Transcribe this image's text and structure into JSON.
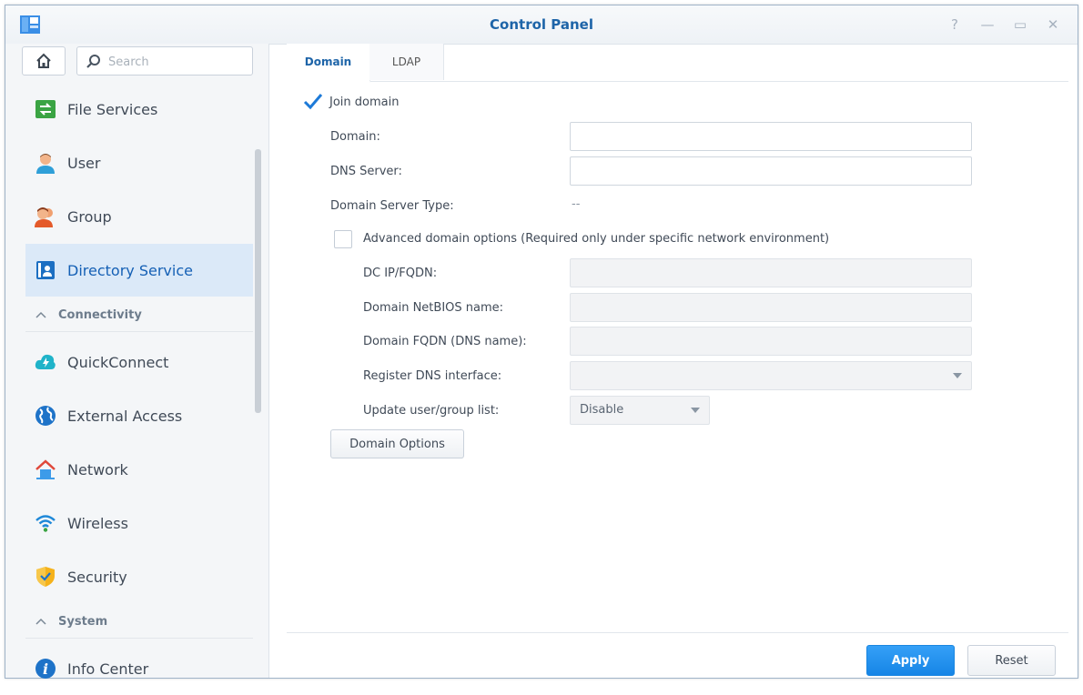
{
  "window": {
    "title": "Control Panel",
    "help_label": "?",
    "minimize_label": "—",
    "maximize_label": "▭",
    "close_label": "✕"
  },
  "sidebar": {
    "search_placeholder": "Search",
    "items_top": [
      {
        "label": "File Services",
        "icon": "file-services-icon"
      },
      {
        "label": "User",
        "icon": "user-icon"
      },
      {
        "label": "Group",
        "icon": "group-icon"
      },
      {
        "label": "Directory Service",
        "icon": "directory-service-icon",
        "active": true
      }
    ],
    "section_connectivity": "Connectivity",
    "items_connectivity": [
      {
        "label": "QuickConnect",
        "icon": "quickconnect-icon"
      },
      {
        "label": "External Access",
        "icon": "external-access-icon"
      },
      {
        "label": "Network",
        "icon": "network-icon"
      },
      {
        "label": "Wireless",
        "icon": "wireless-icon"
      },
      {
        "label": "Security",
        "icon": "security-icon"
      }
    ],
    "section_system": "System",
    "items_system": [
      {
        "label": "Info Center",
        "icon": "info-center-icon"
      }
    ]
  },
  "tabs": [
    {
      "label": "Domain",
      "active": true
    },
    {
      "label": "LDAP",
      "active": false
    }
  ],
  "form": {
    "join_domain_label": "Join domain",
    "join_domain_checked": true,
    "domain_label": "Domain:",
    "domain_value": "",
    "dns_server_label": "DNS Server:",
    "dns_server_value": "",
    "domain_server_type_label": "Domain Server Type:",
    "domain_server_type_value": "--",
    "advanced_label": "Advanced domain options (Required only under specific network environment)",
    "advanced_checked": false,
    "dc_ip_label": "DC IP/FQDN:",
    "netbios_label": "Domain NetBIOS name:",
    "fqdn_label": "Domain FQDN (DNS name):",
    "register_dns_label": "Register DNS interface:",
    "register_dns_value": "",
    "update_list_label": "Update user/group list:",
    "update_list_value": "Disable",
    "domain_options_button": "Domain Options"
  },
  "footer": {
    "apply_label": "Apply",
    "reset_label": "Reset"
  },
  "colors": {
    "accent": "#1d64a8",
    "apply_button": "#1685e6",
    "active_nav_bg": "#dbe9f8"
  }
}
